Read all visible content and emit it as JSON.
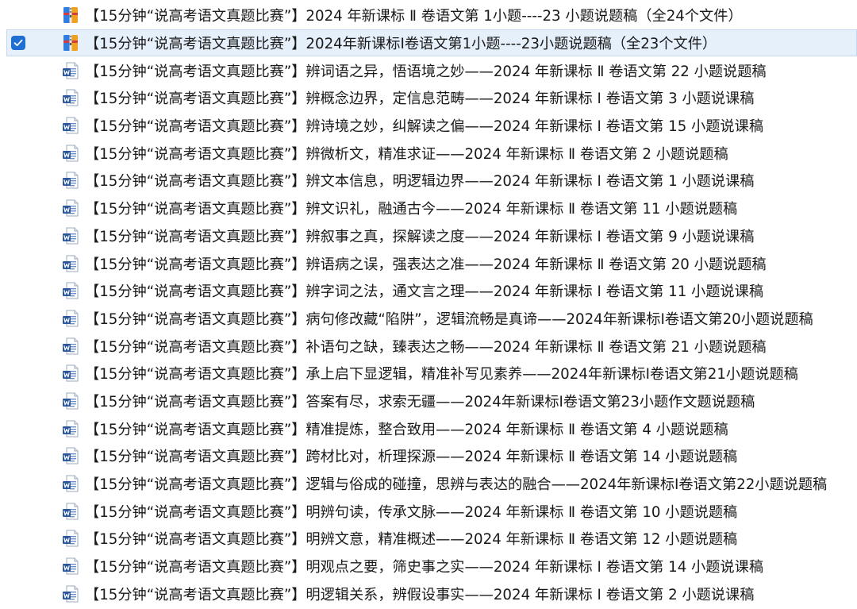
{
  "files": [
    {
      "name": "【15分钟“说高考语文真题比赛”】2024 年新课标 Ⅱ 卷语文第 1小题----23 小题说题稿（全24个文件）",
      "type": "archive",
      "selected": false
    },
    {
      "name": "【15分钟“说高考语文真题比赛”】2024年新课标Ⅰ卷语文第1小题----23小题说题稿（全23个文件）",
      "type": "archive",
      "selected": true
    },
    {
      "name": "【15分钟“说高考语文真题比赛”】辨词语之异，悟语境之妙——2024 年新课标 Ⅱ 卷语文第 22 小题说题稿",
      "type": "word",
      "selected": false
    },
    {
      "name": "【15分钟“说高考语文真题比赛”】辨概念边界，定信息范畴——2024 年新课标 Ⅰ 卷语文第 3 小题说课稿",
      "type": "word",
      "selected": false
    },
    {
      "name": "【15分钟“说高考语文真题比赛”】辨诗境之妙，纠解读之偏——2024 年新课标 Ⅰ 卷语文第 15 小题说课稿",
      "type": "word",
      "selected": false
    },
    {
      "name": "【15分钟“说高考语文真题比赛”】辨微析文，精准求证——2024 年新课标 Ⅱ 卷语文第 2 小题说题稿",
      "type": "word",
      "selected": false
    },
    {
      "name": "【15分钟“说高考语文真题比赛”】辨文本信息，明逻辑边界——2024 年新课标 Ⅰ 卷语文第 1 小题说课稿",
      "type": "word",
      "selected": false
    },
    {
      "name": "【15分钟“说高考语文真题比赛”】辨文识礼，融通古今——2024 年新课标 Ⅱ 卷语文第 11 小题说题稿",
      "type": "word",
      "selected": false
    },
    {
      "name": "【15分钟“说高考语文真题比赛”】辨叙事之真，探解读之度——2024 年新课标 Ⅰ 卷语文第 9 小题说课稿",
      "type": "word",
      "selected": false
    },
    {
      "name": "【15分钟“说高考语文真题比赛”】辨语病之误，强表达之准——2024 年新课标 Ⅱ 卷语文第 20 小题说题稿",
      "type": "word",
      "selected": false
    },
    {
      "name": "【15分钟“说高考语文真题比赛”】辨字词之法，通文言之理——2024 年新课标 Ⅰ 卷语文第 11 小题说课稿",
      "type": "word",
      "selected": false
    },
    {
      "name": "【15分钟“说高考语文真题比赛”】病句修改藏“陷阱”，逻辑流畅是真谛——2024年新课标Ⅰ卷语文第20小题说题稿",
      "type": "word",
      "selected": false
    },
    {
      "name": "【15分钟“说高考语文真题比赛”】补语句之缺，臻表达之畅——2024 年新课标 Ⅱ 卷语文第 21 小题说题稿",
      "type": "word",
      "selected": false
    },
    {
      "name": "【15分钟“说高考语文真题比赛”】承上启下显逻辑，精准补写见素养——2024年新课标Ⅰ卷语文第21小题说题稿",
      "type": "word",
      "selected": false
    },
    {
      "name": "【15分钟“说高考语文真题比赛”】答案有尽，求索无疆——2024年新课标Ⅰ卷语文第23小题作文题说题稿",
      "type": "word",
      "selected": false
    },
    {
      "name": "【15分钟“说高考语文真题比赛”】精准提炼，整合致用——2024 年新课标 Ⅱ 卷语文第 4 小题说题稿",
      "type": "word",
      "selected": false
    },
    {
      "name": "【15分钟“说高考语文真题比赛”】跨材比对，析理探源——2024 年新课标 Ⅱ 卷语文第 14 小题说题稿",
      "type": "word",
      "selected": false
    },
    {
      "name": "【15分钟“说高考语文真题比赛”】逻辑与俗成的碰撞，思辨与表达的融合——2024年新课标Ⅰ卷语文第22小题说题稿",
      "type": "word",
      "selected": false
    },
    {
      "name": "【15分钟“说高考语文真题比赛”】明辨句读，传承文脉——2024 年新课标 Ⅱ 卷语文第 10 小题说题稿",
      "type": "word",
      "selected": false
    },
    {
      "name": "【15分钟“说高考语文真题比赛”】明辨文意，精准概述——2024 年新课标 Ⅱ 卷语文第 12 小题说题稿",
      "type": "word",
      "selected": false
    },
    {
      "name": "【15分钟“说高考语文真题比赛”】明观点之要，筛史事之实——2024 年新课标 Ⅰ 卷语文第 14 小题说课稿",
      "type": "word",
      "selected": false
    },
    {
      "name": "【15分钟“说高考语文真题比赛”】明逻辑关系，辨假设事实——2024 年新课标 Ⅰ 卷语文第 2 小题说课稿",
      "type": "word",
      "selected": false
    }
  ],
  "icons": {
    "archive": "archive-icon",
    "word": "word-document-icon"
  },
  "colors": {
    "selection_bg": "#e5f0fb",
    "selection_border": "#c4d9f1",
    "checkbox": "#1e6fd1",
    "word_blue": "#2b579a"
  }
}
